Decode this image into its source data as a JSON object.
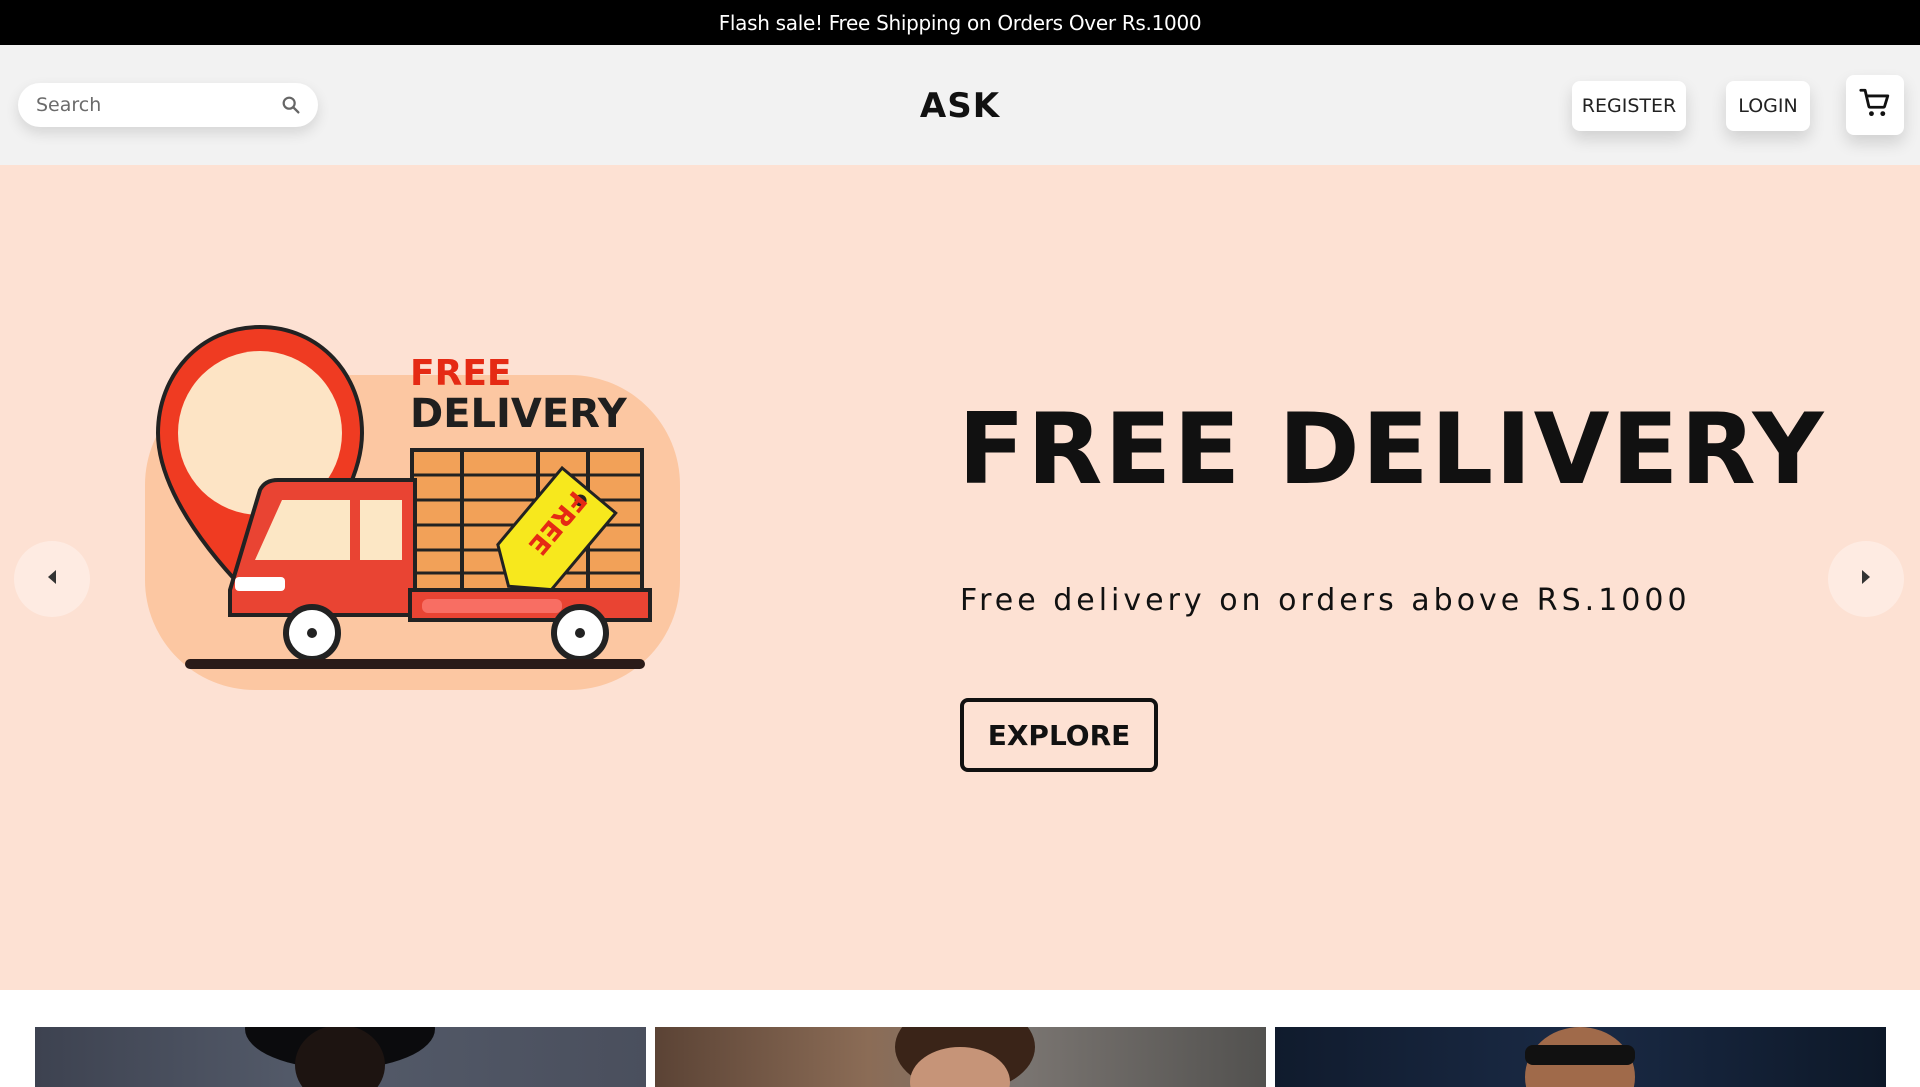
{
  "announcement": {
    "text": "Flash sale! Free Shipping on Orders Over Rs.1000"
  },
  "navbar": {
    "search": {
      "placeholder": "Search",
      "icon": "search-icon"
    },
    "brand": "ASK",
    "register_label": "REGISTER",
    "login_label": "LOGIN",
    "cart_icon": "cart-icon"
  },
  "hero": {
    "illustration": {
      "line1": "FREE",
      "line2": "DELIVERY",
      "tag": "FREE"
    },
    "title": "FREE DELIVERY",
    "subtitle": "Free delivery on orders above RS.1000",
    "cta_label": "EXPLORE",
    "prev_icon": "chevron-left-icon",
    "next_icon": "chevron-right-icon",
    "background_color": "#fde1d3"
  },
  "product_cards": [
    {
      "name": "product-card-1"
    },
    {
      "name": "product-card-2"
    },
    {
      "name": "product-card-3"
    }
  ]
}
